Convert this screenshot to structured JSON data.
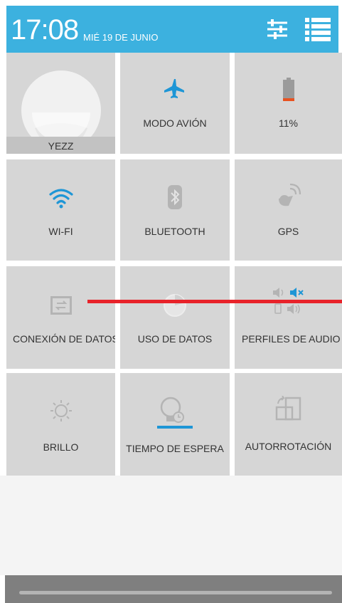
{
  "status_bar": {
    "time": "17:08",
    "date": "MIÉ 19 DE JUNIO",
    "accent_color": "#3cb1df",
    "settings_icon": "sliders-icon",
    "list_icon": "notification-list-icon"
  },
  "tiles": {
    "user": {
      "label": "YEZZ",
      "icon": "user-avatar-icon"
    },
    "airplane": {
      "label": "MODO AVIÓN",
      "icon": "airplane-icon"
    },
    "battery": {
      "label": "11%",
      "icon": "battery-icon",
      "level_percent": 11
    },
    "wifi": {
      "label": "WI-FI",
      "icon": "wifi-icon",
      "active": true
    },
    "bluetooth": {
      "label": "BLUETOOTH",
      "icon": "bluetooth-icon",
      "active": false
    },
    "gps": {
      "label": "GPS",
      "icon": "gps-icon",
      "active": false
    },
    "data": {
      "label": "CONEXIÓN DE DATOS",
      "icon": "data-connection-icon",
      "active": false
    },
    "data_usage": {
      "label": "USO DE DATOS",
      "icon": "data-usage-icon"
    },
    "audio": {
      "label": "PERFILES DE AUDIO",
      "icon": "audio-profiles-icon"
    },
    "brightness": {
      "label": "BRILLO",
      "icon": "brightness-icon"
    },
    "timeout": {
      "label": "TIEMPO DE ESPERA",
      "icon": "screen-timeout-icon"
    },
    "rotation": {
      "label": "AUTORROTACIÓN",
      "icon": "auto-rotate-icon"
    }
  },
  "colors": {
    "tile_bg": "#d6d6d6",
    "active_icon": "#1e96d6",
    "inactive_icon": "#b4b4b4",
    "battery_low": "#e8521f",
    "overlay_line": "#e8232a"
  }
}
